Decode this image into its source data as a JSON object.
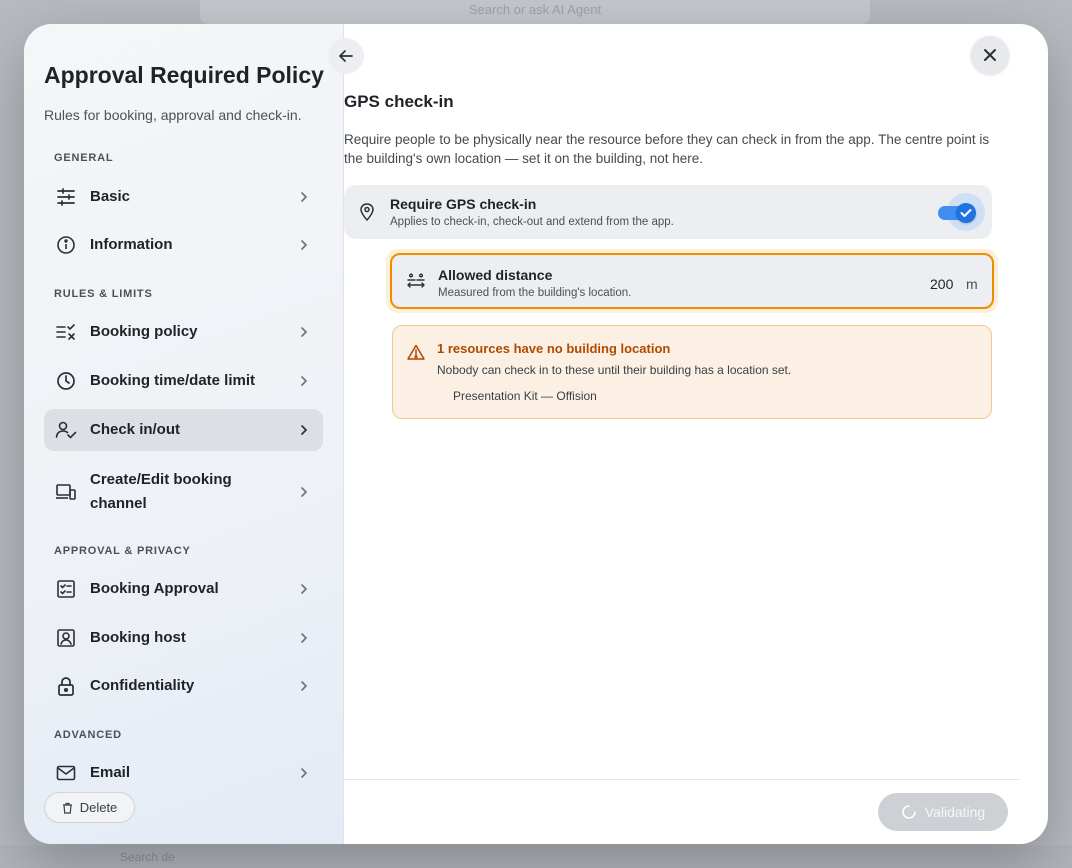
{
  "background": {
    "search_placeholder": "Search or ask AI Agent",
    "footer_text": "Search de"
  },
  "modal": {
    "sidebar": {
      "title": "Approval Required Policy",
      "subtitle": "Rules for booking, approval and check-in.",
      "sections": {
        "general": "GENERAL",
        "rules": "RULES & LIMITS",
        "approval": "APPROVAL & PRIVACY",
        "advanced": "ADVANCED"
      },
      "items": [
        {
          "label": "Basic",
          "icon": "sliders-icon"
        },
        {
          "label": "Information",
          "icon": "info-icon"
        },
        {
          "label": "Booking policy",
          "icon": "list-check-icon"
        },
        {
          "label": "Booking time/date limit",
          "icon": "clock-icon"
        },
        {
          "label": "Check in/out",
          "icon": "user-check-icon",
          "active": true
        },
        {
          "label": "Create/Edit booking channel",
          "icon": "devices-icon"
        },
        {
          "label": "Booking Approval",
          "icon": "checklist-icon"
        },
        {
          "label": "Booking host",
          "icon": "host-icon"
        },
        {
          "label": "Confidentiality",
          "icon": "lock-icon"
        },
        {
          "label": "Email",
          "icon": "mail-icon"
        }
      ],
      "delete_label": "Delete"
    },
    "main": {
      "title": "GPS check-in",
      "description": "Require people to be physically near the resource before they can check in from the app. The centre point is the building's own location — set it on the building, not here.",
      "gps_toggle": {
        "title": "Require GPS check-in",
        "subtitle": "Applies to check-in, check-out and extend from the app.",
        "enabled": true
      },
      "distance": {
        "title": "Allowed distance",
        "subtitle": "Measured from the building's location.",
        "value": "200",
        "unit": "m"
      },
      "warning": {
        "title": "1 resources have no building location",
        "description": "Nobody can check in to these until their building has a location set.",
        "resources": [
          "Presentation Kit — Offision"
        ]
      },
      "validate_label": "Validating"
    }
  },
  "colors": {
    "accent": "#1f72e0",
    "warning": "#b04a00",
    "focus": "#f08c00"
  }
}
